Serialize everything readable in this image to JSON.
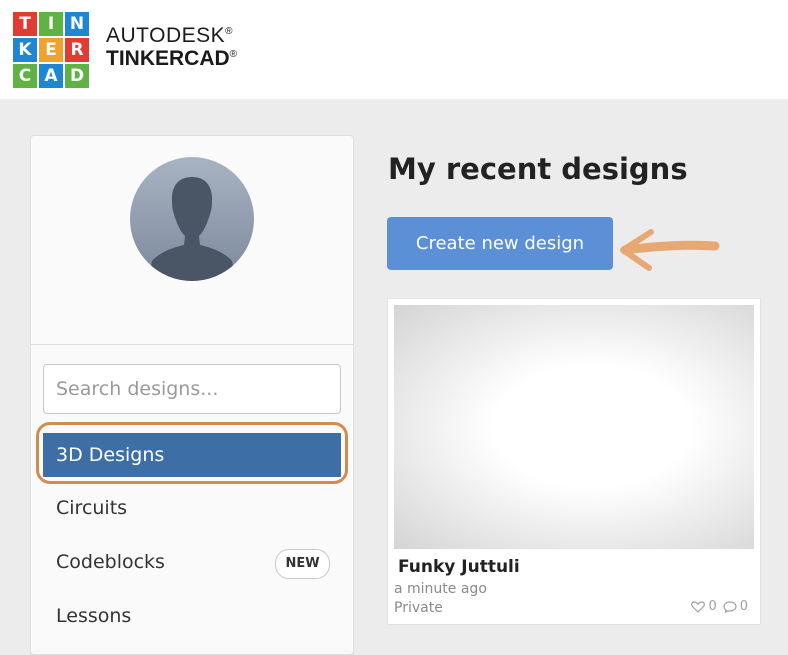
{
  "header": {
    "logo_letters": [
      "T",
      "I",
      "N",
      "K",
      "E",
      "R",
      "C",
      "A",
      "D"
    ],
    "brand_line1": "AUTODESK",
    "brand_line2": "TINKERCAD",
    "brand_mark": "®"
  },
  "sidebar": {
    "search_placeholder": "Search designs...",
    "items": [
      {
        "label": "3D Designs",
        "active": true
      },
      {
        "label": "Circuits"
      },
      {
        "label": "Codeblocks",
        "badge": "NEW"
      },
      {
        "label": "Lessons"
      }
    ]
  },
  "main": {
    "title": "My recent designs",
    "create_button": "Create new design",
    "designs": [
      {
        "name": "Funky Juttuli",
        "time": "a minute ago",
        "privacy": "Private",
        "likes": "0",
        "comments": "0"
      }
    ]
  },
  "colors": {
    "logo_red": "#e23b33",
    "logo_green": "#5fb344",
    "logo_orange": "#f0a22f",
    "logo_blue": "#1f86d4",
    "active_nav": "#3d6fa6",
    "create_button": "#5b8fd6",
    "annotation_orange": "#d18c52"
  },
  "icons": [
    "user-silhouette-icon",
    "heart-icon",
    "comment-icon",
    "annotation-arrow-icon"
  ]
}
